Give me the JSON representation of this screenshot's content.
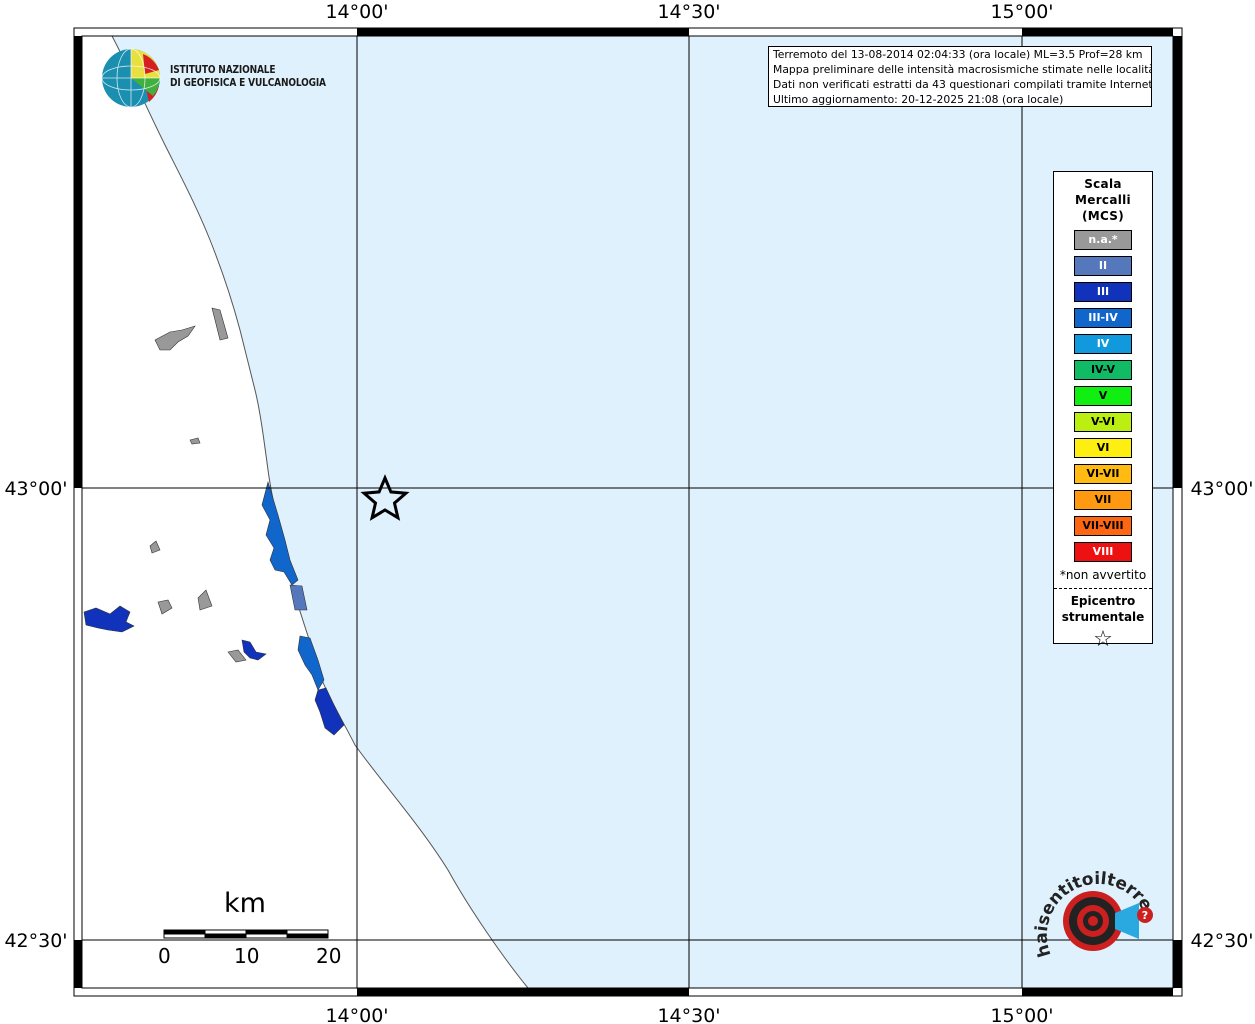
{
  "map": {
    "lon_labels": [
      "14°00'",
      "14°30'",
      "15°00'"
    ],
    "lat_labels": [
      "43°00'",
      "42°30'"
    ],
    "epicenter_symbol": "star-icon"
  },
  "info": {
    "line1": "Terremoto del 13-08-2014 02:04:33 (ora locale) ML=3.5 Prof=28 km",
    "line2": "Mappa preliminare delle intensità macrosismiche stimate nelle località",
    "line3": "Dati non verificati estratti da 43 questionari compilati tramite Internet.",
    "line4": "Ultimo aggiornamento: 20-12-2025 21:08 (ora locale)"
  },
  "logo": {
    "line1": "ISTITUTO NAZIONALE",
    "line2": "DI GEOFISICA E VULCANOLOGIA"
  },
  "legend": {
    "title1": "Scala",
    "title2": "Mercalli",
    "title3": "(MCS)",
    "items": [
      {
        "label": "n.a.*",
        "color": "#999999",
        "text_color": "#ffffff"
      },
      {
        "label": "II",
        "color": "#5577bb",
        "text_color": "#ffffff"
      },
      {
        "label": "III",
        "color": "#1133bb",
        "text_color": "#ffffff"
      },
      {
        "label": "III-IV",
        "color": "#1166cc",
        "text_color": "#ffffff"
      },
      {
        "label": "IV",
        "color": "#1199dd",
        "text_color": "#ffffff"
      },
      {
        "label": "IV-V",
        "color": "#11bb66",
        "text_color": "#000000"
      },
      {
        "label": "V",
        "color": "#11ee11",
        "text_color": "#000000"
      },
      {
        "label": "V-VI",
        "color": "#bbee11",
        "text_color": "#000000"
      },
      {
        "label": "VI",
        "color": "#ffee11",
        "text_color": "#000000"
      },
      {
        "label": "VI-VII",
        "color": "#ffbb11",
        "text_color": "#000000"
      },
      {
        "label": "VII",
        "color": "#ff9911",
        "text_color": "#000000"
      },
      {
        "label": "VII-VIII",
        "color": "#ff6611",
        "text_color": "#000000"
      },
      {
        "label": "VIII",
        "color": "#ee1111",
        "text_color": "#ffffff"
      }
    ],
    "note": "*non avvertito",
    "epi1": "Epicentro",
    "epi2": "strumentale",
    "epi_symbol": "☆"
  },
  "scale": {
    "unit": "km",
    "ticks": [
      "0",
      "10",
      "20"
    ]
  },
  "colors": {
    "sea": "#dff1fc",
    "land": "#ffffff",
    "intensity_II": "#5577bb",
    "intensity_III": "#1133bb",
    "intensity_IIIIV": "#1166cc",
    "na": "#999999"
  },
  "watermark_text": "haisentitoilterremoto.it www."
}
